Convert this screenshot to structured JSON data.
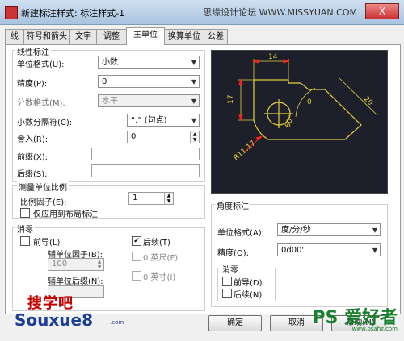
{
  "window": {
    "title": "新建标注样式: 标注样式-1",
    "close_glyph": "X"
  },
  "watermark": {
    "top": "思缘设计论坛 WWW.MISSYUAN.COM",
    "logo_line1": "搜学吧",
    "logo_line2": "Souxue8",
    "logo_line2_tail": ".com",
    "ps_logo": "PS 爱好者",
    "ps_sub": "www.psahz.com"
  },
  "tabs": [
    "线",
    "符号和箭头",
    "文字",
    "调整",
    "主单位",
    "换算单位",
    "公差"
  ],
  "linear": {
    "group_title": "线性标注",
    "unit_format_label": "单位格式(U):",
    "unit_format_value": "小数",
    "precision_label": "精度(P):",
    "precision_value": "0",
    "fraction_label": "分数格式(M):",
    "fraction_value": "水平",
    "decimal_sep_label": "小数分隔符(C):",
    "decimal_sep_value": "“.” (句点)",
    "round_label": "舍入(R):",
    "round_value": "0",
    "prefix_label": "前缀(X):",
    "prefix_value": "",
    "suffix_label": "后缀(S):",
    "suffix_value": ""
  },
  "scale": {
    "group_title": "测量单位比例",
    "factor_label": "比例因子(E):",
    "factor_value": "1",
    "layout_only_label": "仅应用到布局标注",
    "layout_only_checked": false
  },
  "zero_linear": {
    "group_title": "消零",
    "leading_label": "前导(L)",
    "leading_checked": false,
    "trailing_label": "后续(T)",
    "trailing_checked": true,
    "sub_factor_label": "辅单位因子(B):",
    "sub_factor_value": "100",
    "feet_label": "0 英尺(F)",
    "inches_label": "0 英寸(I)",
    "sub_suffix_label": "辅单位后缀(N):",
    "sub_suffix_value": ""
  },
  "preview_dims": {
    "top": "14",
    "left": "17",
    "right": "20",
    "angle": "60°",
    "radius": "R11.17",
    "arc": "0"
  },
  "angular": {
    "group_title": "角度标注",
    "unit_format_label": "单位格式(A):",
    "unit_format_value": "度/分/秒",
    "precision_label": "精度(O):",
    "precision_value": "0d00'",
    "zero_title": "消零",
    "leading_label": "前导(D)",
    "leading_checked": false,
    "trailing_label": "后续(N)",
    "trailing_checked": false
  },
  "buttons": {
    "ok": "确定",
    "cancel": "取消",
    "help": "帮助(H)"
  },
  "colors": {
    "preview_bg": "#1d1f2a",
    "preview_line": "#e6d23a",
    "dim_line": "#ff2020"
  }
}
